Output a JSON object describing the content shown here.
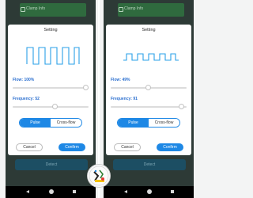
{
  "screens": [
    {
      "bg_header_text": "Clamp Info",
      "bg_button_text": "Detect",
      "dialog": {
        "title": "Setting",
        "flow_label": "Flow: 100%",
        "flow_value": 1.0,
        "frequency_label": "Frequency: 52",
        "frequency_value": 0.55,
        "modes": [
          "Pulse",
          "Cross-flow"
        ],
        "selected_mode": "Pulse",
        "cancel": "Cancel",
        "confirm": "Confirm",
        "wave": "square-full-amplitude"
      }
    },
    {
      "bg_header_text": "Clamp Info",
      "bg_button_text": "Detect",
      "dialog": {
        "title": "Setting",
        "flow_label": "Flow: 49%",
        "flow_value": 0.49,
        "frequency_label": "Frequency: 91",
        "frequency_value": 0.93,
        "modes": [
          "Pulse",
          "Cross-flow"
        ],
        "selected_mode": "Pulse",
        "cancel": "Cancel",
        "confirm": "Confirm",
        "wave": "square-half-amplitude"
      }
    }
  ],
  "nav_icons": [
    "back-icon",
    "home-icon",
    "recent-apps-icon"
  ],
  "colors": {
    "accent": "#1e88e5",
    "label": "#2b6fcf",
    "wave": "#2aa0e8",
    "background": "#2d3a36"
  }
}
